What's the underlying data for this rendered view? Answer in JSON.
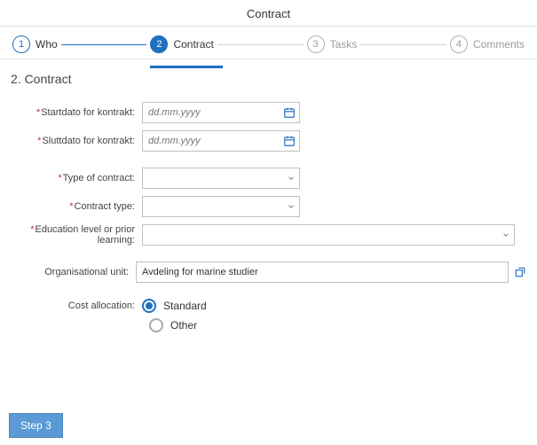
{
  "page_title": "Contract",
  "stepper": {
    "steps": [
      {
        "num": "1",
        "label": "Who"
      },
      {
        "num": "2",
        "label": "Contract"
      },
      {
        "num": "3",
        "label": "Tasks"
      },
      {
        "num": "4",
        "label": "Comments"
      }
    ]
  },
  "section_title": "2. Contract",
  "labels": {
    "start": "Startdato for kontrakt:",
    "end": "Sluttdato for kontrakt:",
    "type_of_contract": "Type of contract:",
    "contract_type": "Contract type:",
    "education": "Education level or prior learning:",
    "org_unit": "Organisational unit:",
    "cost_alloc": "Cost allocation:"
  },
  "placeholders": {
    "date": "dd.mm.yyyy"
  },
  "values": {
    "org_unit": "Avdeling for marine studier"
  },
  "radio": {
    "standard": "Standard",
    "other": "Other"
  },
  "footer": {
    "next": "Step 3"
  }
}
